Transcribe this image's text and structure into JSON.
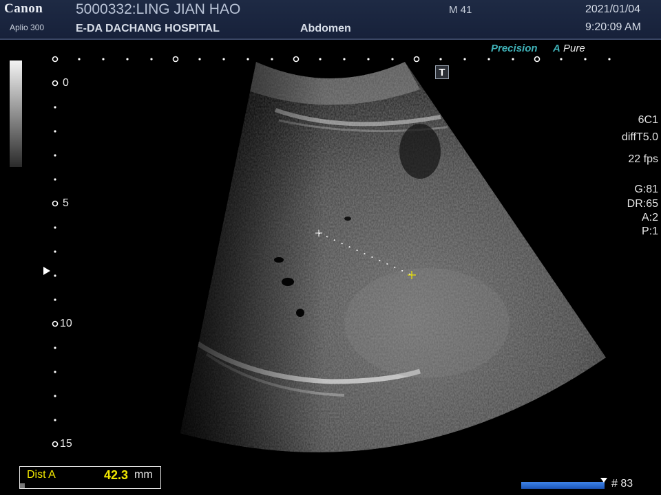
{
  "header": {
    "brand": "Canon",
    "model": "Aplio 300",
    "patient": "5000332:LING JIAN HAO",
    "hospital": "E-DA DACHANG HOSPITAL",
    "exam": "Abdomen",
    "mi": "M 41",
    "date": "2021/01/04",
    "time": "9:20:09 AM"
  },
  "modes": {
    "precision": "Precision",
    "apure_a": "A",
    "apure_rest": "Pure"
  },
  "params": {
    "probe": "6C1",
    "preset": "diffT5.0",
    "fps": "22 fps",
    "gain": "G:81",
    "dr": "DR:65",
    "a": "A:2",
    "p": "P:1"
  },
  "tbutton": "T",
  "depth_labels": [
    "0",
    "5",
    "10",
    "15"
  ],
  "measurement": {
    "label": "Dist A",
    "value": "42.3",
    "unit": "mm"
  },
  "cine": {
    "frame": "# 83"
  },
  "colors": {
    "header_bg": "#1b2540",
    "measure_yellow": "#f2e800",
    "accent_teal": "#3fb2b8",
    "cine_blue": "#2f6fd6"
  }
}
